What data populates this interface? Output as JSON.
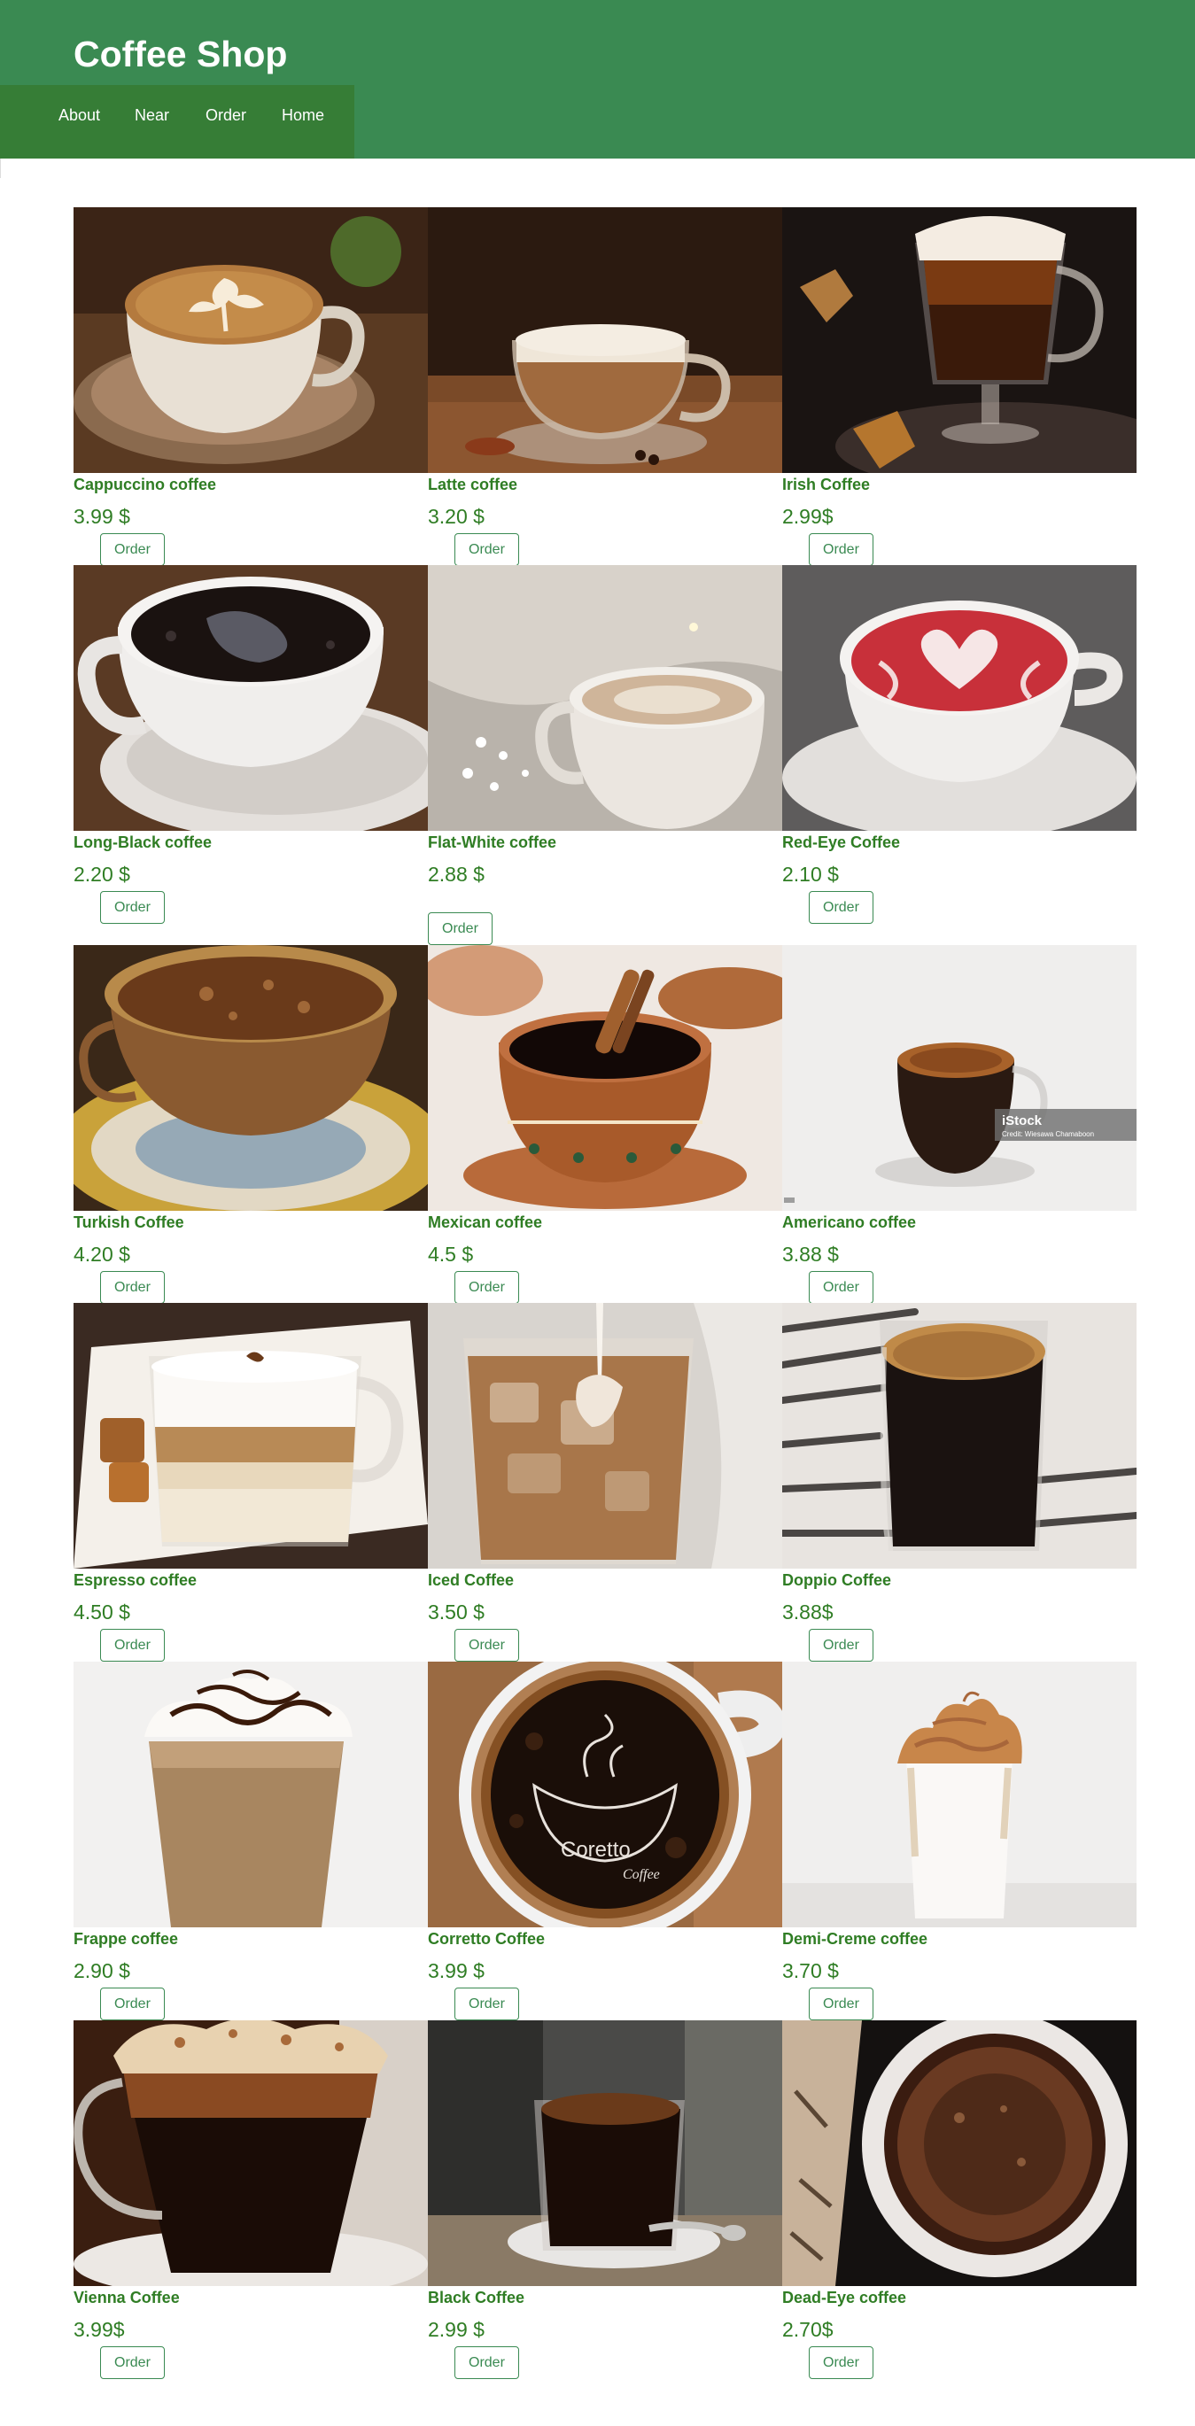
{
  "header": {
    "title": "Coffee Shop",
    "nav": [
      {
        "label": "About"
      },
      {
        "label": "Near"
      },
      {
        "label": "Order"
      },
      {
        "label": "Home"
      }
    ],
    "background_color": "#3a8a52",
    "nav_background_color": "#367d36"
  },
  "products": [
    {
      "name": "Cappuccino coffee",
      "price": "3.99 $",
      "order_label": "Order",
      "photo": "cappuccino-latte-art-photo"
    },
    {
      "name": "Latte coffee",
      "price": "3.20 $",
      "order_label": "Order",
      "photo": "latte-glass-cup-photo"
    },
    {
      "name": "Irish Coffee",
      "price": "2.99$",
      "order_label": "Order",
      "photo": "irish-coffee-glass-photo"
    },
    {
      "name": "Long-Black coffee",
      "price": "2.20 $",
      "order_label": "Order",
      "photo": "long-black-cup-photo"
    },
    {
      "name": "Flat-White coffee",
      "price": "2.88 $",
      "order_label": "Order",
      "photo": "flat-white-mug-photo"
    },
    {
      "name": "Red-Eye Coffee",
      "price": "2.10 $",
      "order_label": "Order",
      "photo": "red-eye-heart-art-photo"
    },
    {
      "name": "Turkish Coffee",
      "price": "4.20 $",
      "order_label": "Order",
      "photo": "turkish-coffee-cup-photo"
    },
    {
      "name": "Mexican coffee",
      "price": "4.5 $",
      "order_label": "Order",
      "photo": "mexican-coffee-cinnamon-photo"
    },
    {
      "name": "Americano coffee",
      "price": "3.88 $",
      "order_label": "Order",
      "photo": "americano-glass-cup-photo",
      "watermark": "iStock",
      "watermark_credit": "Credit: Wiesawa Chamaboon"
    },
    {
      "name": "Espresso coffee",
      "price": "4.50 $",
      "order_label": "Order",
      "photo": "layered-espresso-mug-photo"
    },
    {
      "name": "Iced Coffee",
      "price": "3.50 $",
      "order_label": "Order",
      "photo": "iced-coffee-glass-photo"
    },
    {
      "name": "Doppio Coffee",
      "price": "3.88$",
      "order_label": "Order",
      "photo": "doppio-glass-newspaper-photo"
    },
    {
      "name": "Frappe coffee",
      "price": "2.90 $",
      "order_label": "Order",
      "photo": "frappe-whipped-cream-photo"
    },
    {
      "name": "Corretto Coffee",
      "price": "3.99 $",
      "order_label": "Order",
      "photo": "corretto-cup-top-view-photo",
      "logo_text": "Coretto",
      "logo_subtext": "Coffee"
    },
    {
      "name": "Demi-Creme coffee",
      "price": "3.70 $",
      "order_label": "Order",
      "photo": "dalgona-cream-glass-photo"
    },
    {
      "name": "Vienna Coffee",
      "price": "3.99$",
      "order_label": "Order",
      "photo": "vienna-coffee-cream-photo"
    },
    {
      "name": "Black Coffee",
      "price": "2.99 $",
      "order_label": "Order",
      "photo": "black-coffee-glass-photo"
    },
    {
      "name": "Dead-Eye coffee",
      "price": "2.70$",
      "order_label": "Order",
      "photo": "dead-eye-cup-top-view-photo"
    }
  ],
  "colors": {
    "product_text": "#2f7d24",
    "button_border": "#3a8a52"
  }
}
